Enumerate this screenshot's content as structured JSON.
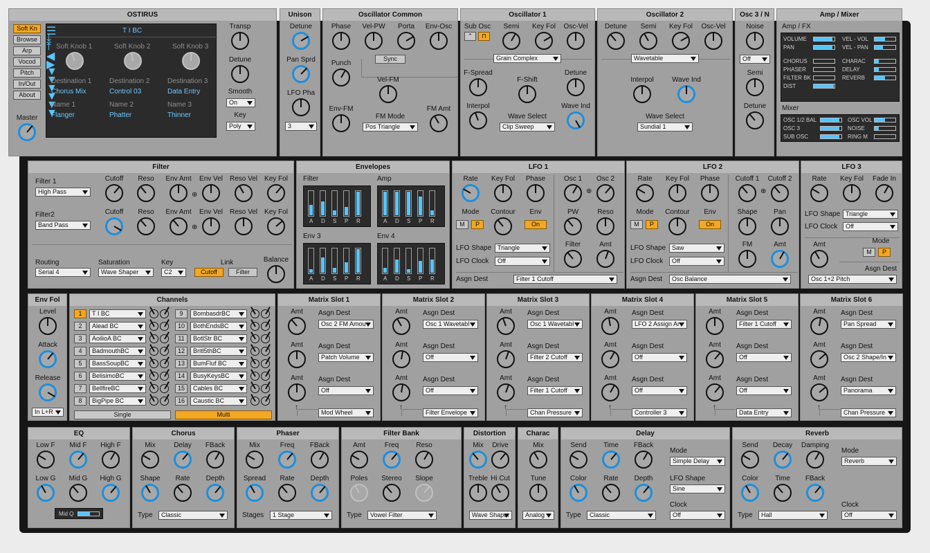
{
  "ostirus": {
    "title": "OSTIRUS",
    "sidebar": [
      "Soft Kn",
      "Browse",
      "Arp",
      "Vocod",
      "Pitch",
      "In/Out",
      "About"
    ],
    "master": "Master",
    "preset": "T I BC",
    "knobs": [
      "Soft Knob 1",
      "Soft Knob 2",
      "Soft Knob 3"
    ],
    "dests": [
      "Destination 1",
      "Destination 2",
      "Destination 3"
    ],
    "dest_vals": [
      "Chorus Mix",
      "Control 03",
      "Data Entry"
    ],
    "names": [
      "Name 1",
      "Name 2",
      "Name 3"
    ],
    "name_vals": [
      "Flanger",
      "Phatter",
      "Thinner"
    ],
    "transp": "Transp",
    "detune": "Detune",
    "smooth": "Smooth",
    "smooth_val": "On",
    "key": "Key",
    "key_val": "Poly"
  },
  "unison": {
    "title": "Unison",
    "detune": "Detune",
    "pan": "Pan Sprd",
    "lfo": "LFO Pha",
    "val": "3"
  },
  "osc_common": {
    "title": "Oscillator Common",
    "phase": "Phase",
    "velpw": "Vel-PW",
    "porta": "Porta",
    "envosc": "Env-Osc",
    "punch": "Punch",
    "sync": "Sync",
    "velfm": "Vel-FM",
    "envfm": "Env-FM",
    "fmmode": "FM Mode",
    "fmmode_val": "Pos Triangle",
    "fmamt": "FM Amt"
  },
  "osc1": {
    "title": "Oscillator 1",
    "subosc": "Sub Osc",
    "semi": "Semi",
    "keyfol": "Key Fol",
    "oscvel": "Osc-Vel",
    "shape": "Grain Complex",
    "fspread": "F-Spread",
    "fshift": "F-Shift",
    "detune": "Detune",
    "interpol": "Interpol",
    "wavesel": "Wave Select",
    "wavesel_val": "Clip Sweep",
    "waveind": "Wave Ind"
  },
  "osc2": {
    "title": "Oscillator 2",
    "detune": "Detune",
    "semi": "Semi",
    "keyfol": "Key Fol",
    "oscvel": "Osc-Vel",
    "shape": "Wavetable",
    "interpol": "Interpol",
    "waveind": "Wave Ind",
    "wavesel": "Wave Select",
    "wavesel_val": "Sundial 1"
  },
  "osc3": {
    "title": "Osc 3 / N",
    "noise": "Noise",
    "val": "Off",
    "semi": "Semi",
    "detune": "Detune"
  },
  "ampmix": {
    "title": "Amp / Mixer",
    "fx": "Amp / FX",
    "mixer": "Mixer",
    "fx_rows": [
      [
        "VOLUME",
        "VEL - VOL"
      ],
      [
        "PAN",
        "VEL - PAN"
      ],
      [
        "CHORUS",
        "CHARAC"
      ],
      [
        "PHASER",
        "DELAY"
      ],
      [
        "FILTER BK",
        "REVERB"
      ],
      [
        "DIST",
        ""
      ]
    ],
    "mix_rows": [
      [
        "OSC 1/2 BAL",
        "OSC VOL"
      ],
      [
        "OSC 3",
        "NOISE"
      ],
      [
        "SUB OSC",
        "RING M"
      ]
    ]
  },
  "filter": {
    "title": "Filter",
    "f1": "Filter 1",
    "f1_val": "High Pass",
    "f2": "Filter2",
    "f2_val": "Band Pass",
    "cutoff": "Cutoff",
    "reso": "Reso",
    "envamt": "Env Amt",
    "envvel": "Env Vel",
    "resovel": "Reso Vel",
    "keyfol": "Key Fol",
    "routing": "Routing",
    "routing_val": "Serial 4",
    "saturation": "Saturation",
    "sat_val": "Wave Shaper",
    "key": "Key",
    "key_val": "C2",
    "link": "Link",
    "link_a": "Cutoff",
    "link_b": "Filter",
    "balance": "Balance"
  },
  "env": {
    "title": "Envelopes",
    "names": [
      "Filter",
      "Amp",
      "Env 3",
      "Env 4"
    ],
    "stages": [
      "A",
      "D",
      "S",
      "P",
      "R"
    ],
    "levels": [
      [
        0.45,
        0.6,
        0.2,
        0.35,
        1.0
      ],
      [
        1.0,
        1.0,
        1.0,
        0.8,
        0.2
      ],
      [
        0.15,
        0.65,
        0.2,
        0.45,
        1.0
      ],
      [
        0.2,
        0.55,
        0.15,
        0.5,
        0.55
      ]
    ]
  },
  "lfo1": {
    "title": "LFO 1",
    "rate": "Rate",
    "keyfol": "Key Fol",
    "phase": "Phase",
    "osc1": "Osc 1",
    "osc2": "Osc 2",
    "mode": "Mode",
    "contour": "Contour",
    "env": "Env",
    "env_val": "On",
    "pw": "PW",
    "reso": "Reso",
    "filter": "Filter",
    "amt": "Amt",
    "shape": "LFO Shape",
    "shape_val": "Triangle",
    "clock": "LFO Clock",
    "clock_val": "Off",
    "asgn": "Asgn Dest",
    "asgn_val": "Filter 1 Cutoff",
    "m": "M",
    "p": "P"
  },
  "lfo2": {
    "title": "LFO 2",
    "rate": "Rate",
    "keyfol": "Key Fol",
    "phase": "Phase",
    "cut1": "Cutoff 1",
    "cut2": "Cutoff 2",
    "mode": "Mode",
    "contour": "Contour",
    "env": "Env",
    "env_val": "On",
    "shape2": "Shape",
    "pan": "Pan",
    "fm": "FM",
    "amt": "Amt",
    "shape": "LFO Shape",
    "shape_val": "Saw",
    "clock": "LFO Clock",
    "clock_val": "Off",
    "asgn": "Asgn Dest",
    "asgn_val": "Osc Balance",
    "m": "M",
    "p": "P"
  },
  "lfo3": {
    "title": "LFO 3",
    "rate": "Rate",
    "keyfol": "Key Fol",
    "fade": "Fade In",
    "shape": "LFO Shape",
    "shape_val": "Triangle",
    "clock": "LFO Clock",
    "clock_val": "Off",
    "amt": "Amt",
    "mode": "Mode",
    "asgn": "Asgn Dest",
    "asgn_val": "Osc 1+2 Pitch",
    "m": "M",
    "p": "P"
  },
  "envfol": {
    "title": "Env Fol",
    "level": "Level",
    "attack": "Attack",
    "release": "Release",
    "val": "In L+R"
  },
  "channels": {
    "title": "Channels",
    "left": [
      [
        "1",
        "T I BC"
      ],
      [
        "2",
        "Alead BC"
      ],
      [
        "3",
        "AoilioA BC"
      ],
      [
        "4",
        "BadmouthBC"
      ],
      [
        "5",
        "BassSoupBC"
      ],
      [
        "6",
        "BelisimoBC"
      ],
      [
        "7",
        "BellfireBC"
      ],
      [
        "8",
        "BigPipe BC"
      ]
    ],
    "right": [
      [
        "9",
        "BombasdrBC"
      ],
      [
        "10",
        "BothEndsBC"
      ],
      [
        "11",
        "BotlStr BC"
      ],
      [
        "12",
        "Britl5thBC"
      ],
      [
        "13",
        "BumFluf BC"
      ],
      [
        "14",
        "BusyKeysBC"
      ],
      [
        "15",
        "Cables BC"
      ],
      [
        "16",
        "Caustic BC"
      ]
    ],
    "single": "Single",
    "multi": "Multi"
  },
  "matrix": [
    {
      "title": "Matrix Slot 1",
      "amt": "Amt",
      "asgn": "Asgn Dest",
      "dests": [
        "Osc 2 FM Amou",
        "Patch Volume",
        "Off"
      ],
      "src": "Mod Wheel"
    },
    {
      "title": "Matrix Slot 2",
      "amt": "Amt",
      "asgn": "Asgn Dest",
      "dests": [
        "Osc 1 Wavetabl",
        "Off",
        "Off"
      ],
      "src": "Filter Envelope"
    },
    {
      "title": "Matrix Slot 3",
      "amt": "Amt",
      "asgn": "Asgn Dest",
      "dests": [
        "Osc 1 Wavetabl",
        "Filter 2 Cutoff",
        "Filter 1 Cutoff"
      ],
      "src": "Chan Pressure"
    },
    {
      "title": "Matrix Slot 4",
      "amt": "Amt",
      "asgn": "Asgn Dest",
      "dests": [
        "LFO 2 Assign Ar",
        "Off",
        "Off"
      ],
      "src": "Controller 3"
    },
    {
      "title": "Matrix Slot 5",
      "amt": "Amt",
      "asgn": "Asgn Dest",
      "dests": [
        "Filter 1 Cutoff",
        "Off",
        "Off"
      ],
      "src": "Data Entry"
    },
    {
      "title": "Matrix Slot 6",
      "amt": "Amt",
      "asgn": "Asgn Dest",
      "dests": [
        "Pan Spread",
        "Osc 2 Shape/In",
        "Panorama"
      ],
      "src": "Chan Pressure"
    }
  ],
  "eq": {
    "title": "EQ",
    "labels": [
      "Low F",
      "Mid F",
      "High F",
      "Low G",
      "Mid G",
      "High G"
    ],
    "midq": "Mid Q",
    "midq_level": 0.55
  },
  "chorus": {
    "title": "Chorus",
    "labels": [
      "Mix",
      "Delay",
      "FBack",
      "Shape",
      "Rate",
      "Depth"
    ],
    "type": "Type",
    "type_val": "Classic"
  },
  "phaser": {
    "title": "Phaser",
    "labels": [
      "Mix",
      "Freq",
      "FBack",
      "Spread",
      "Rate",
      "Depth"
    ],
    "stages": "Stages",
    "stages_val": "1 Stage"
  },
  "filterbank": {
    "title": "Filter Bank",
    "labels": [
      "Amt",
      "Freq",
      "Reso",
      "Poles",
      "Stereo",
      "Slope"
    ],
    "type": "Type",
    "type_val": "Vowel Filter"
  },
  "distortion": {
    "title": "Distortion",
    "labels": [
      "Mix",
      "Drive",
      "Treble",
      "Hi Cut"
    ],
    "val": "Wave Shaper"
  },
  "charac": {
    "title": "Charac",
    "labels": [
      "Mix",
      "Tune"
    ],
    "val": "Analog"
  },
  "delay": {
    "title": "Delay",
    "labels": [
      "Send",
      "Time",
      "FBack",
      "Color",
      "Rate",
      "Depth"
    ],
    "mode": "Mode",
    "mode_val": "Simple Delay",
    "lfo": "LFO Shape",
    "lfo_val": "Sine",
    "clock": "Clock",
    "clock_val": "Off",
    "type": "Type",
    "type_val": "Classic"
  },
  "reverb": {
    "title": "Reverb",
    "labels": [
      "Send",
      "Decay",
      "Damping",
      "Color",
      "Time",
      "FBack"
    ],
    "mode": "Mode",
    "mode_val": "Reverb",
    "clock": "Clock",
    "clock_val": "Off",
    "type": "Type",
    "type_val": "Hall"
  }
}
